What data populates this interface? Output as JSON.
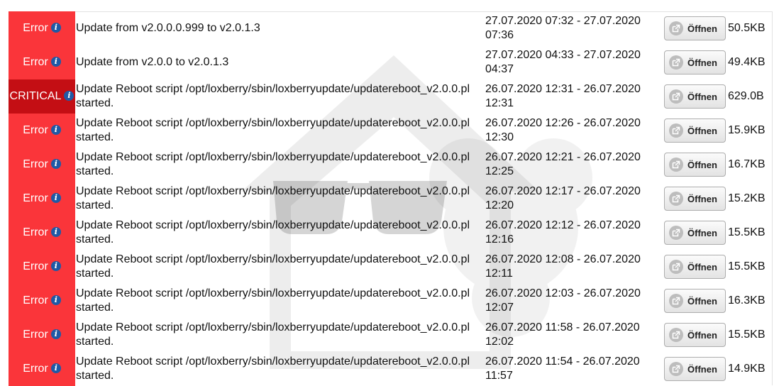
{
  "levels": {
    "error": "Error",
    "critical": "CRITICAL"
  },
  "button_label": "Öffnen",
  "colors": {
    "error": "#fa353a",
    "critical": "#c40e14",
    "info_icon": "#1f5aa6"
  },
  "rows": [
    {
      "level": "Error",
      "message_line1": "Update from v2.0.0.0.999 to v2.0.1.3",
      "message_line2": "",
      "time_line1": "27.07.2020 07:32 - 27.07.2020",
      "time_line2": "07:36",
      "size": "50.5KB"
    },
    {
      "level": "Error",
      "message_line1": "Update from v2.0.0 to v2.0.1.3",
      "message_line2": "",
      "time_line1": "27.07.2020 04:33 - 27.07.2020",
      "time_line2": "04:37",
      "size": "49.4KB"
    },
    {
      "level": "CRITICAL",
      "message_line1": "Update Reboot script /opt/loxberry/sbin/loxberryupdate/updatereboot_v2.0.0.pl",
      "message_line2": "started.",
      "time_line1": "26.07.2020 12:31 - 26.07.2020",
      "time_line2": "12:31",
      "size": "629.0B"
    },
    {
      "level": "Error",
      "message_line1": "Update Reboot script /opt/loxberry/sbin/loxberryupdate/updatereboot_v2.0.0.pl",
      "message_line2": "started.",
      "time_line1": "26.07.2020 12:26 - 26.07.2020",
      "time_line2": "12:30",
      "size": "15.9KB"
    },
    {
      "level": "Error",
      "message_line1": "Update Reboot script /opt/loxberry/sbin/loxberryupdate/updatereboot_v2.0.0.pl",
      "message_line2": "started.",
      "time_line1": "26.07.2020 12:21 - 26.07.2020",
      "time_line2": "12:25",
      "size": "16.7KB"
    },
    {
      "level": "Error",
      "message_line1": "Update Reboot script /opt/loxberry/sbin/loxberryupdate/updatereboot_v2.0.0.pl",
      "message_line2": "started.",
      "time_line1": "26.07.2020 12:17 - 26.07.2020",
      "time_line2": "12:20",
      "size": "15.2KB"
    },
    {
      "level": "Error",
      "message_line1": "Update Reboot script /opt/loxberry/sbin/loxberryupdate/updatereboot_v2.0.0.pl",
      "message_line2": "started.",
      "time_line1": "26.07.2020 12:12 - 26.07.2020",
      "time_line2": "12:16",
      "size": "15.5KB"
    },
    {
      "level": "Error",
      "message_line1": "Update Reboot script /opt/loxberry/sbin/loxberryupdate/updatereboot_v2.0.0.pl",
      "message_line2": "started.",
      "time_line1": "26.07.2020 12:08 - 26.07.2020",
      "time_line2": "12:11",
      "size": "15.5KB"
    },
    {
      "level": "Error",
      "message_line1": "Update Reboot script /opt/loxberry/sbin/loxberryupdate/updatereboot_v2.0.0.pl",
      "message_line2": "started.",
      "time_line1": "26.07.2020 12:03 - 26.07.2020",
      "time_line2": "12:07",
      "size": "16.3KB"
    },
    {
      "level": "Error",
      "message_line1": "Update Reboot script /opt/loxberry/sbin/loxberryupdate/updatereboot_v2.0.0.pl",
      "message_line2": "started.",
      "time_line1": "26.07.2020 11:58 - 26.07.2020",
      "time_line2": "12:02",
      "size": "15.5KB"
    },
    {
      "level": "Error",
      "message_line1": "Update Reboot script /opt/loxberry/sbin/loxberryupdate/updatereboot_v2.0.0.pl",
      "message_line2": "started.",
      "time_line1": "26.07.2020 11:54 - 26.07.2020",
      "time_line2": "11:57",
      "size": "14.9KB"
    }
  ]
}
